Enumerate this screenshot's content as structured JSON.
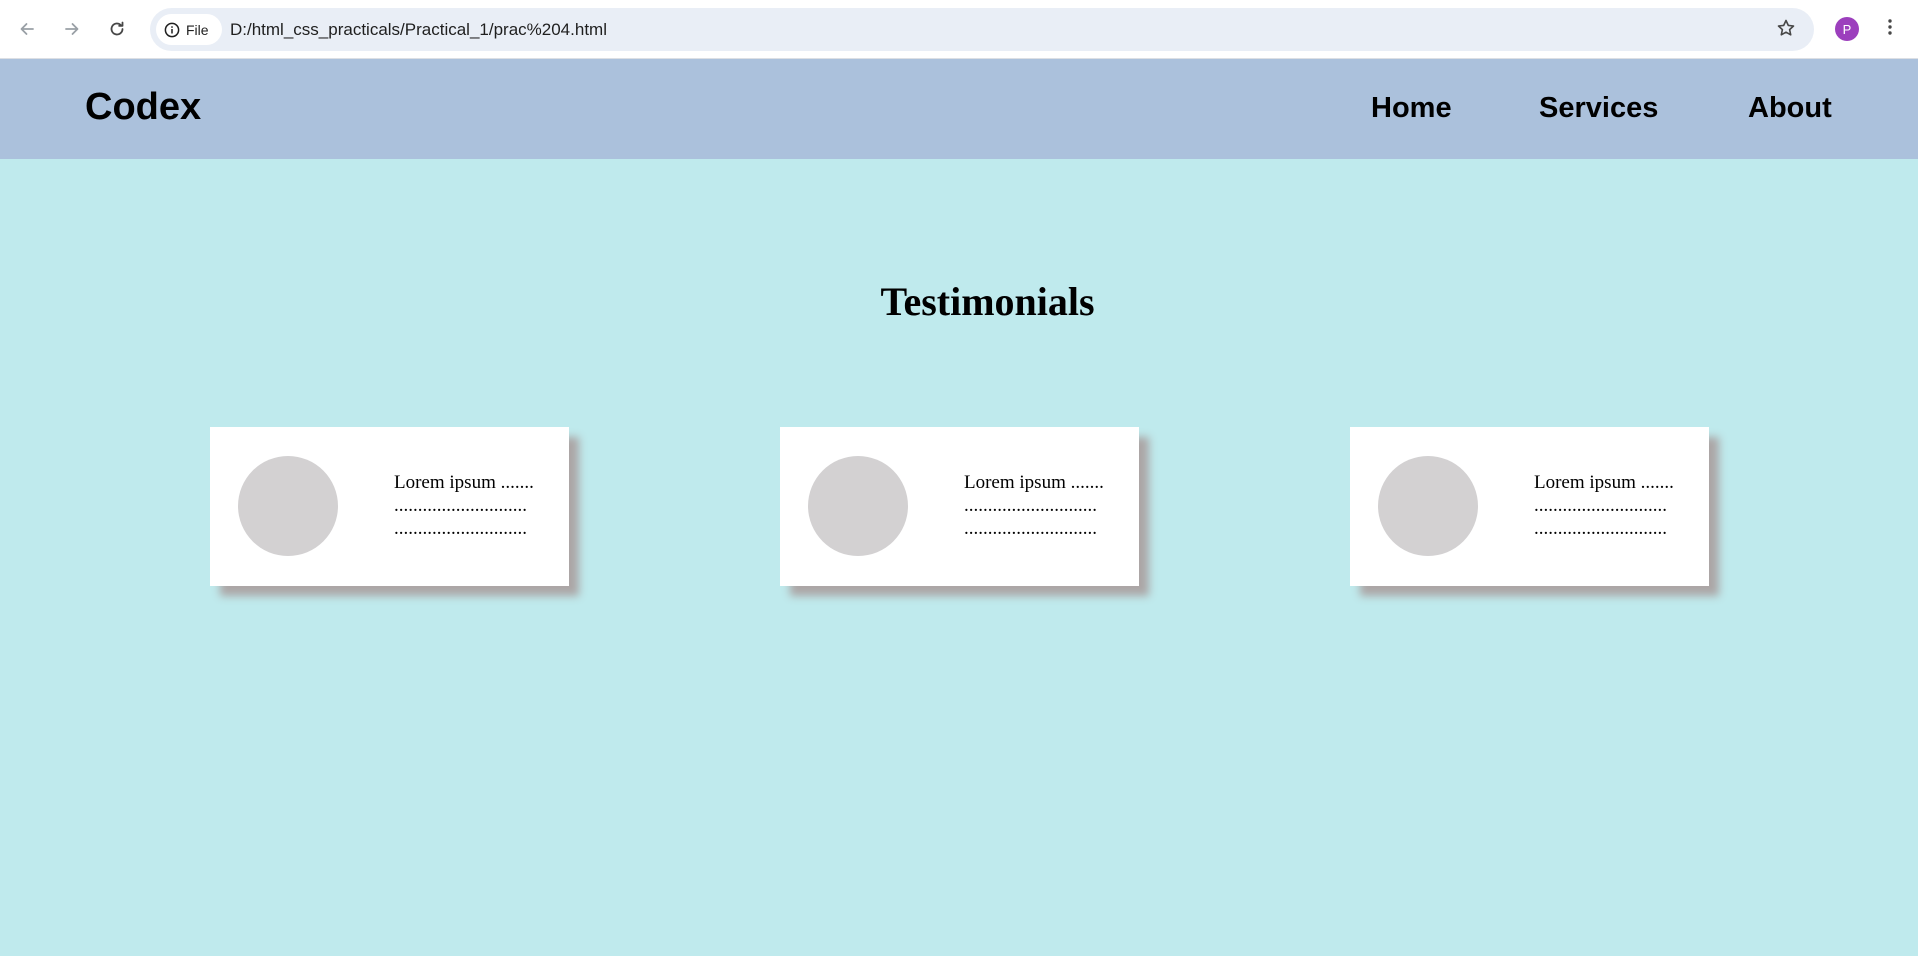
{
  "browser": {
    "site_chip_label": "File",
    "url": "D:/html_css_practicals/Practical_1/prac%204.html",
    "profile_initial": "P",
    "profile_color": "#9c3fbd"
  },
  "header": {
    "logo": "Codex",
    "nav": [
      {
        "label": "Home"
      },
      {
        "label": "Services"
      },
      {
        "label": "About"
      }
    ],
    "bg_color": "#abc1dc"
  },
  "main": {
    "title": "Testimonials",
    "bg_color": "#bfeaed",
    "cards": [
      {
        "text": "Lorem ipsum ....... ............................ ............................"
      },
      {
        "text": "Lorem ipsum ....... ............................ ............................"
      },
      {
        "text": "Lorem ipsum ....... ............................ ............................"
      }
    ]
  }
}
